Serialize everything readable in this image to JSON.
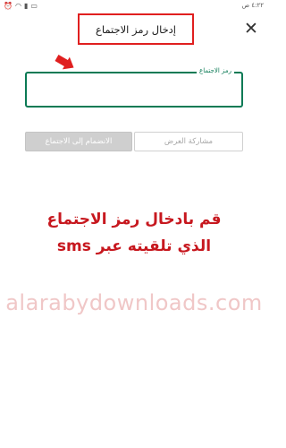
{
  "status_bar": {
    "time": "٤:٢٢ ص",
    "icons": [
      "alarm-icon",
      "wifi-icon",
      "signal-icon",
      "battery-icon"
    ]
  },
  "dialog": {
    "title": "إدخال رمز الاجتماع",
    "close_icon": "close-icon",
    "field": {
      "label": "رمز الاجتماع",
      "value": ""
    },
    "buttons": {
      "share_label": "مشاركة العرض",
      "join_label": "الانضمام إلى الاجتماع"
    }
  },
  "annotation": {
    "line1": "قم بادخال رمز الاجتماع",
    "line2": "الذي تلقيته عبر sms"
  },
  "watermark": "alarabydownloads.com",
  "colors": {
    "accent": "#0b7a55",
    "annotation_red": "#c7181f",
    "highlight_red": "#e01f1f"
  }
}
